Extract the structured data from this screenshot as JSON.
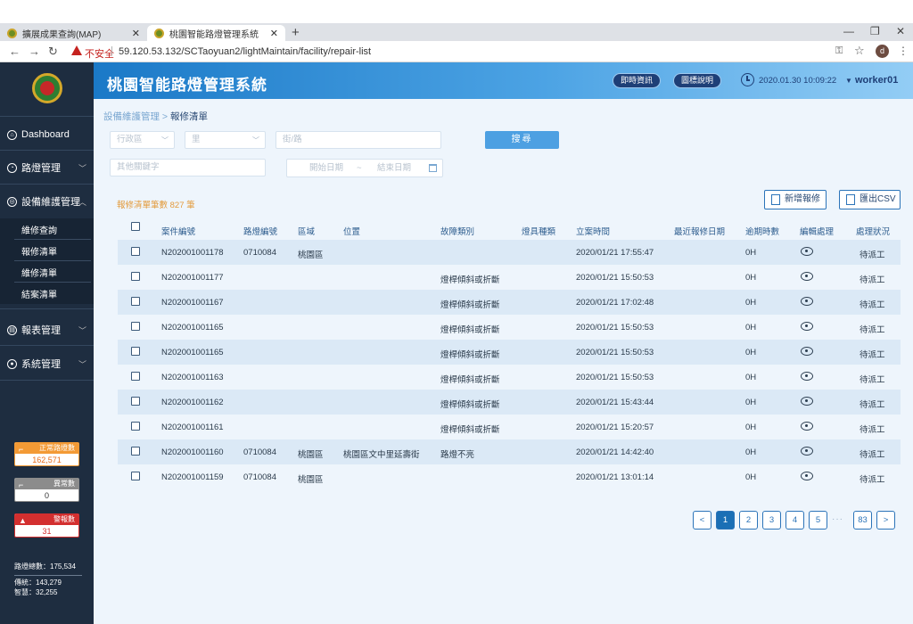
{
  "browser": {
    "tabs": [
      {
        "title": "擴展成果查詢(MAP)"
      },
      {
        "title": "桃園智能路燈管理系統"
      }
    ],
    "address": {
      "security_label": "不安全",
      "url": "59.120.53.132/SCTaoyuan2/lightMaintain/facility/repair-list"
    },
    "profile_initial": "d"
  },
  "header": {
    "system_title": "桃園智能路燈管理系統",
    "btn_realtime": "即時資訊",
    "btn_legend": "圖標說明",
    "datetime": "2020.01.30 10:09:22",
    "username": "worker01"
  },
  "sidebar": {
    "menu": [
      {
        "label": "Dashboard"
      },
      {
        "label": "路燈管理"
      },
      {
        "label": "設備維護管理"
      },
      {
        "label": "報表管理"
      },
      {
        "label": "系統管理"
      }
    ],
    "submenu": [
      {
        "label": "維修查詢"
      },
      {
        "label": "報修清單"
      },
      {
        "label": "維修清單"
      },
      {
        "label": "結案清單"
      }
    ],
    "stats": {
      "normal_label": "正常路燈數",
      "normal_value": "162,571",
      "abnormal_label": "異常數",
      "abnormal_value": "0",
      "alarm_label": "警報數",
      "alarm_value": "31"
    },
    "totals": {
      "total": "路燈總數：175,534",
      "traditional": "傳統：143,279",
      "smart": "智慧：32,255"
    }
  },
  "main": {
    "breadcrumb": {
      "parent": "設備維護管理",
      "separator": ">",
      "current": "報修清單"
    },
    "filters": {
      "district_placeholder": "行政區",
      "village_placeholder": "里",
      "street_placeholder": "街/路",
      "keyword_placeholder": "其他關鍵字",
      "start_date_placeholder": "開始日期",
      "date_separator": "~",
      "end_date_placeholder": "結束日期",
      "search_label": "搜尋"
    },
    "count_label": "報修清單筆數 827 筆",
    "btn_add": "新增報修",
    "btn_export": "匯出CSV",
    "columns": [
      "案件編號",
      "路燈編號",
      "區域",
      "位置",
      "故障類別",
      "燈具種類",
      "立案時間",
      "最近報修日期",
      "逾期時數",
      "編輯處理",
      "處理狀況"
    ],
    "rows": [
      {
        "case": "N202001001178",
        "lamp": "0710084",
        "area": "桃園區",
        "location": "",
        "fault": "",
        "fixture": "",
        "filed": "2020/01/21 17:55:47",
        "last": "",
        "overdue": "0H",
        "status": "待派工"
      },
      {
        "case": "N202001001177",
        "lamp": "",
        "area": "",
        "location": "",
        "fault": "燈桿傾斜或折斷",
        "fixture": "",
        "filed": "2020/01/21 15:50:53",
        "last": "",
        "overdue": "0H",
        "status": "待派工"
      },
      {
        "case": "N202001001167",
        "lamp": "",
        "area": "",
        "location": "",
        "fault": "燈桿傾斜或折斷",
        "fixture": "",
        "filed": "2020/01/21 17:02:48",
        "last": "",
        "overdue": "0H",
        "status": "待派工"
      },
      {
        "case": "N202001001165",
        "lamp": "",
        "area": "",
        "location": "",
        "fault": "燈桿傾斜或折斷",
        "fixture": "",
        "filed": "2020/01/21 15:50:53",
        "last": "",
        "overdue": "0H",
        "status": "待派工"
      },
      {
        "case": "N202001001165",
        "lamp": "",
        "area": "",
        "location": "",
        "fault": "燈桿傾斜或折斷",
        "fixture": "",
        "filed": "2020/01/21 15:50:53",
        "last": "",
        "overdue": "0H",
        "status": "待派工"
      },
      {
        "case": "N202001001163",
        "lamp": "",
        "area": "",
        "location": "",
        "fault": "燈桿傾斜或折斷",
        "fixture": "",
        "filed": "2020/01/21 15:50:53",
        "last": "",
        "overdue": "0H",
        "status": "待派工"
      },
      {
        "case": "N202001001162",
        "lamp": "",
        "area": "",
        "location": "",
        "fault": "燈桿傾斜或折斷",
        "fixture": "",
        "filed": "2020/01/21 15:43:44",
        "last": "",
        "overdue": "0H",
        "status": "待派工"
      },
      {
        "case": "N202001001161",
        "lamp": "",
        "area": "",
        "location": "",
        "fault": "燈桿傾斜或折斷",
        "fixture": "",
        "filed": "2020/01/21 15:20:57",
        "last": "",
        "overdue": "0H",
        "status": "待派工"
      },
      {
        "case": "N202001001160",
        "lamp": "0710084",
        "area": "桃園區",
        "location": "桃園區文中里延壽街",
        "fault": "路燈不亮",
        "fixture": "",
        "filed": "2020/01/21 14:42:40",
        "last": "",
        "overdue": "0H",
        "status": "待派工"
      },
      {
        "case": "N202001001159",
        "lamp": "0710084",
        "area": "桃園區",
        "location": "",
        "fault": "",
        "fixture": "",
        "filed": "2020/01/21 13:01:14",
        "last": "",
        "overdue": "0H",
        "status": "待派工"
      }
    ],
    "pagination": {
      "prev": "<",
      "pages": [
        "1",
        "2",
        "3",
        "4",
        "5"
      ],
      "ellipsis": "···",
      "last": "83",
      "next": ">"
    }
  }
}
